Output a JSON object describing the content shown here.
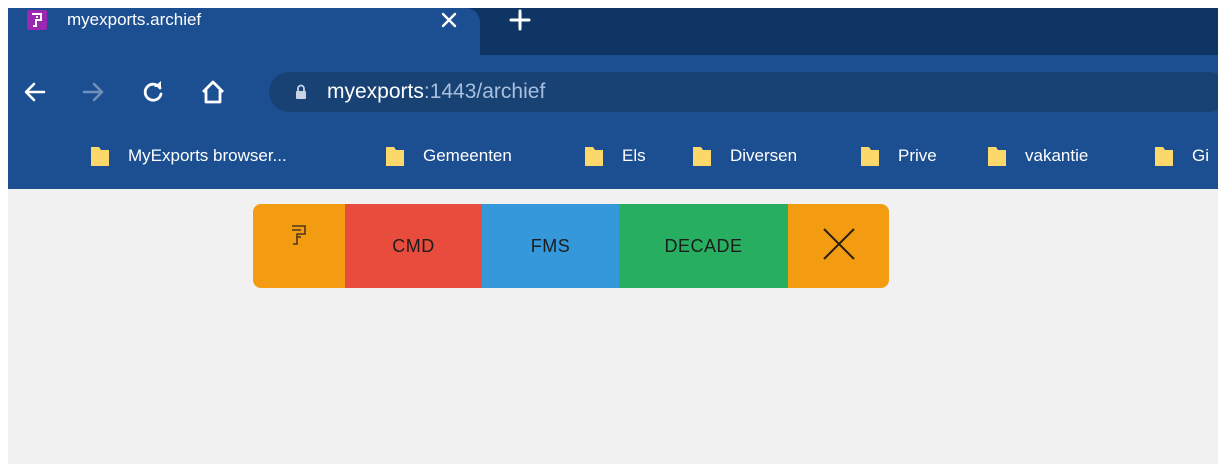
{
  "browser": {
    "tab": {
      "title": "myexports.archief",
      "favicon": "myexports-favicon",
      "favicon_color": "#9c27b0"
    },
    "new_tab_icon": "plus-icon",
    "url": {
      "host": "myexports",
      "rest": ":1443/archief"
    },
    "bookmarks": [
      {
        "label": "MyExports browser..."
      },
      {
        "label": "Gemeenten"
      },
      {
        "label": "Els"
      },
      {
        "label": "Diversen"
      },
      {
        "label": "Prive"
      },
      {
        "label": "vakantie"
      },
      {
        "label": "Gi"
      }
    ],
    "colors": {
      "frame": "#1c4f91",
      "tabstrip": "#0e3563",
      "omnibox": "#174273",
      "folder": "#fcd769"
    }
  },
  "appbar": {
    "buttons": [
      {
        "label": "",
        "icon": "myexports-logo-icon",
        "color": "#f39c12"
      },
      {
        "label": "CMD",
        "color": "#e74c3c"
      },
      {
        "label": "FMS",
        "color": "#3498db"
      },
      {
        "label": "DECADE",
        "color": "#27ae60"
      },
      {
        "label": "",
        "icon": "close-icon",
        "color": "#f39c12"
      }
    ]
  }
}
